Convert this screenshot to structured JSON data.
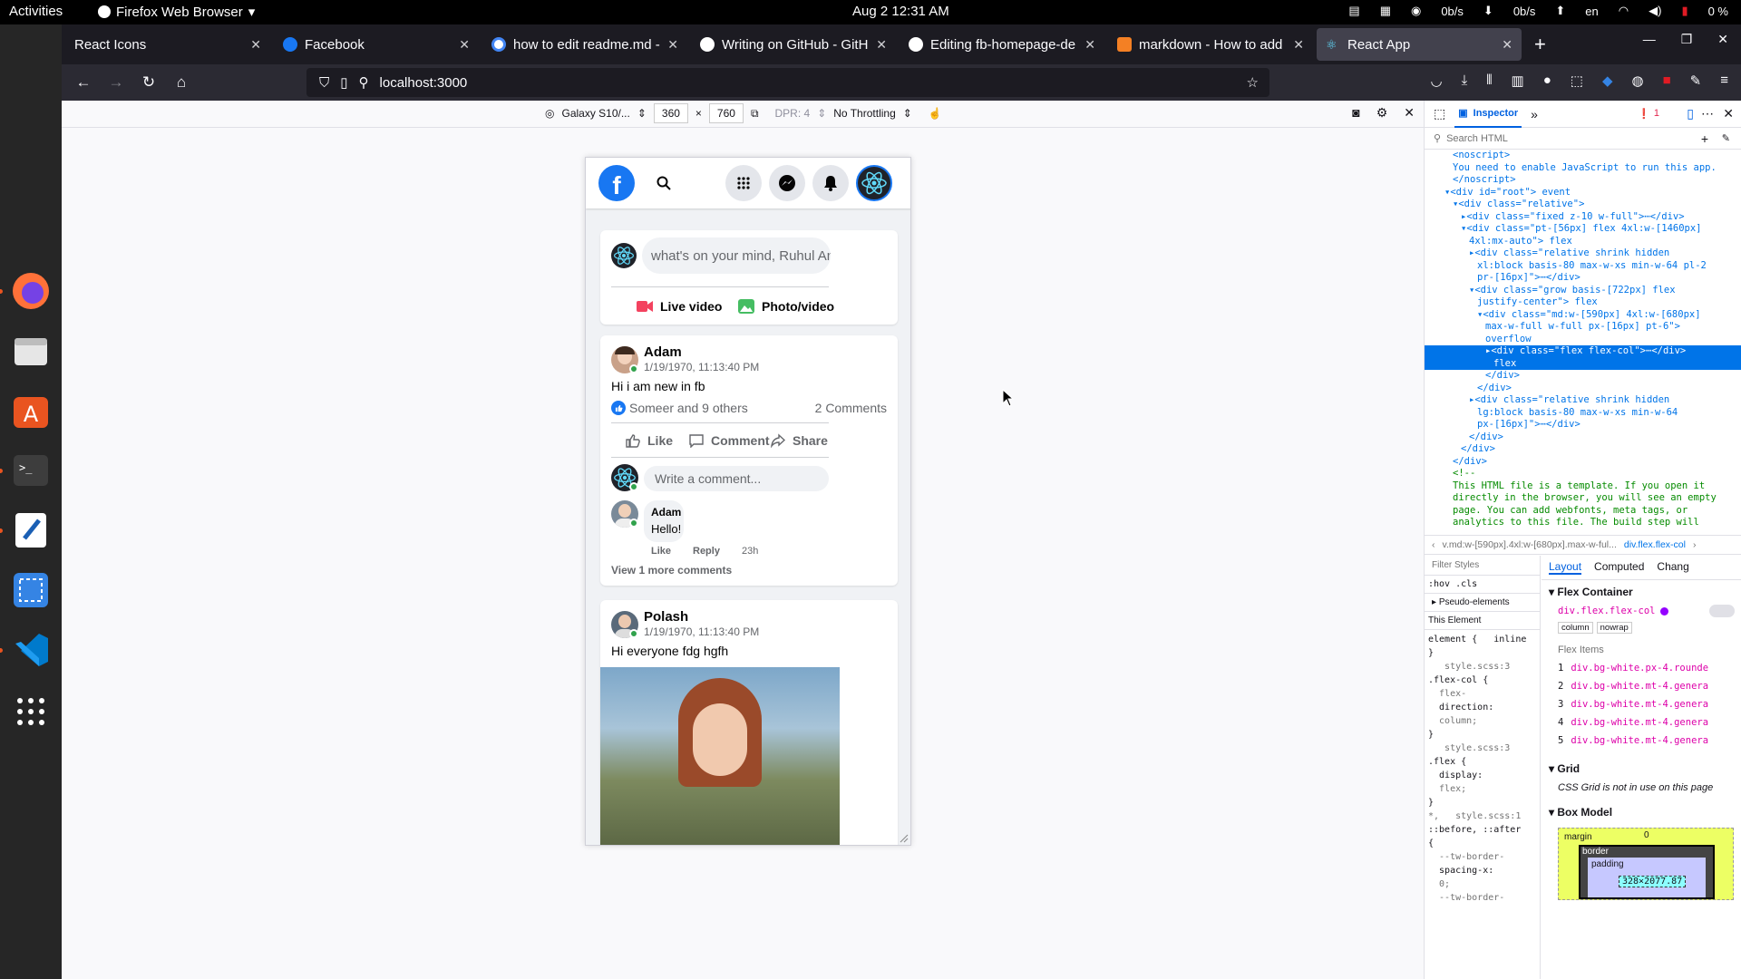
{
  "topbar": {
    "activities": "Activities",
    "app_menu": "Firefox Web Browser",
    "clock": "Aug 2  12:31 AM",
    "net_down": "0b/s",
    "net_up": "0b/s",
    "language": "en",
    "battery": "0 %"
  },
  "tabs": [
    {
      "label": "React Icons"
    },
    {
      "label": "Facebook"
    },
    {
      "label": "how to edit readme.md - "
    },
    {
      "label": "Writing on GitHub - GitHu"
    },
    {
      "label": "Editing fb-homepage-de"
    },
    {
      "label": "markdown - How to add"
    },
    {
      "label": "React App"
    }
  ],
  "url": "localhost:3000",
  "rdm": {
    "device": "Galaxy S10/...",
    "width": "360",
    "height": "760",
    "dpr": "DPR: 4",
    "throttling": "No Throttling",
    "times": "×"
  },
  "fb": {
    "composer_placeholder": "what's on your mind, Ruhul Amin'",
    "live_video": "Live video",
    "photo_video": "Photo/video",
    "posts": [
      {
        "author": "Adam",
        "time": "1/19/1970, 11:13:40 PM",
        "text": "Hi i am new in fb",
        "reactions": "Someer and 9 others",
        "comments_count": "2 Comments",
        "like": "Like",
        "comment": "Comment",
        "share": "Share",
        "comment_placeholder": "Write a comment...",
        "comment_author": "Adam",
        "comment_text": "Hello!",
        "comment_like": "Like",
        "comment_reply": "Reply",
        "comment_time": "23h",
        "view_more": "View 1 more comments"
      },
      {
        "author": "Polash",
        "time": "1/19/1970, 11:13:40 PM",
        "text": "Hi everyone fdg hgfh"
      }
    ]
  },
  "devtools": {
    "inspector": "Inspector",
    "error_count": "1",
    "search_placeholder": "Search HTML",
    "dom_lines": [
      {
        "text": "<noscript>",
        "indent": 3
      },
      {
        "text": "You need to enable JavaScript to run this app.",
        "indent": 3
      },
      {
        "text": "</noscript>",
        "indent": 3
      },
      {
        "text": "▾<div id=\"root\"> event",
        "indent": 2
      },
      {
        "text": "▾<div class=\"relative\">",
        "indent": 3
      },
      {
        "text": "▸<div class=\"fixed z-10 w-full\">⋯</div>",
        "indent": 4
      },
      {
        "text": "▾<div class=\"pt-[56px] flex 4xl:w-[1460px]",
        "indent": 4
      },
      {
        "text": "4xl:mx-auto\"> flex",
        "indent": 5
      },
      {
        "text": "▸<div class=\"relative shrink hidden",
        "indent": 5
      },
      {
        "text": "xl:block basis-80 max-w-xs min-w-64 pl-2",
        "indent": 6
      },
      {
        "text": "pr-[16px]\">⋯</div>",
        "indent": 6
      },
      {
        "text": "▾<div class=\"grow basis-[722px] flex",
        "indent": 5
      },
      {
        "text": "justify-center\"> flex",
        "indent": 6
      },
      {
        "text": "▾<div class=\"md:w-[590px] 4xl:w-[680px]",
        "indent": 6
      },
      {
        "text": "max-w-full w-full px-[16px] pt-6\">",
        "indent": 7
      },
      {
        "text": "overflow",
        "indent": 7
      },
      {
        "text": "▸<div class=\"flex flex-col\">⋯</div>",
        "indent": 7,
        "selected": true
      },
      {
        "text": "flex",
        "indent": 8,
        "selected": true
      },
      {
        "text": "</div>",
        "indent": 7
      },
      {
        "text": "</div>",
        "indent": 6
      },
      {
        "text": "▸<div class=\"relative shrink hidden",
        "indent": 5
      },
      {
        "text": "lg:block basis-80 max-w-xs min-w-64",
        "indent": 6
      },
      {
        "text": "px-[16px]\">⋯</div>",
        "indent": 6
      },
      {
        "text": "</div>",
        "indent": 5
      },
      {
        "text": "</div>",
        "indent": 4
      },
      {
        "text": "</div>",
        "indent": 3
      },
      {
        "text": "<!--",
        "indent": 3,
        "comment": true
      },
      {
        "text": "This HTML file is a template. If you open it",
        "indent": 3,
        "comment": true
      },
      {
        "text": "directly in the browser, you will see an empty",
        "indent": 3,
        "comment": true
      },
      {
        "text": "page. You can add webfonts, meta tags, or",
        "indent": 3,
        "comment": true
      },
      {
        "text": "analytics to this file. The build step will",
        "indent": 3,
        "comment": true
      }
    ],
    "breadcrumb_path": "v.md:w-[590px].4xl:w-[680px].max-w-ful...",
    "breadcrumb_current": "div.flex.flex-col",
    "filter_styles": "Filter Styles",
    "pseudo": ":hov  .cls",
    "pseudo_elements": "Pseudo-elements",
    "this_element": "This Element",
    "layout_tabs": [
      "Layout",
      "Computed",
      "Chang"
    ],
    "rules": [
      "element {   inline",
      "}",
      "   style.scss:3",
      ".flex-col {",
      "  flex-",
      "  direction:",
      "  column;",
      "}",
      "   style.scss:3",
      ".flex {",
      "  display:",
      "  flex;",
      "}",
      "*,   style.scss:1",
      "::before, ::after",
      "{",
      "  --tw-border-",
      "  spacing-x:",
      "  0;",
      "  --tw-border-"
    ],
    "flex_container": "Flex Container",
    "flex_selector": "div.flex.flex-col",
    "flex_tags": [
      "column",
      "nowrap"
    ],
    "flex_items_title": "Flex Items",
    "flex_items": [
      "div.bg-white.px-4.rounde",
      "div.bg-white.mt-4.genera",
      "div.bg-white.mt-4.genera",
      "div.bg-white.mt-4.genera",
      "div.bg-white.mt-4.genera"
    ],
    "grid_title": "Grid",
    "grid_note": "CSS Grid is not in use on this page",
    "box_model_title": "Box Model",
    "box_margin": "margin",
    "box_border": "border",
    "box_padding": "padding",
    "box_size": "328×2077.87",
    "box_zero": "0"
  },
  "colors": {
    "fb_blue": "#1877f2",
    "online_green": "#31a24c",
    "react_cyan": "#61dafb",
    "devtools_selection": "#0074e8"
  }
}
